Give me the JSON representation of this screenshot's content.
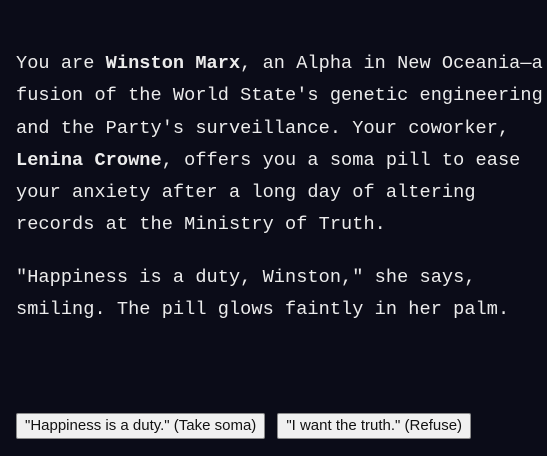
{
  "story": {
    "p1_a": "You are ",
    "p1_name": "Winston Marx",
    "p1_b": ", an Alpha in New Oceania—a fusion of the World State's genetic engineering and the Party's surveillance. Your coworker, ",
    "p1_coworker": "Lenina Crowne",
    "p1_c": ", offers you a soma pill to ease your anxiety after a long day of altering records at the Ministry of Truth.",
    "p2": "\"Happiness is a duty, Winston,\" she says, smiling. The pill glows faintly in her palm."
  },
  "choices": [
    {
      "label": "\"Happiness is a duty.\" (Take soma)"
    },
    {
      "label": "\"I want the truth.\" (Refuse)"
    }
  ],
  "colors": {
    "background": "#0b0c18",
    "text": "#ececec"
  }
}
